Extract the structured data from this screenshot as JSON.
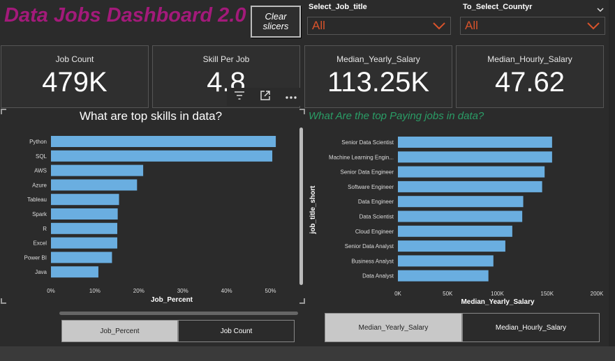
{
  "header": {
    "title": "Data Jobs Dashboard 2.0",
    "clear_button": "Clear slicers"
  },
  "slicers": [
    {
      "label": "Select_Job_title",
      "value": "All"
    },
    {
      "label": "To_Select_Countyr",
      "value": "All"
    }
  ],
  "kpis": [
    {
      "label": "Job Count",
      "value": "479K"
    },
    {
      "label": "Skill Per Job",
      "value": "4.8"
    },
    {
      "label": "Median_Yearly_Salary",
      "value": "113.25K"
    },
    {
      "label": "Median_Hourly_Salary",
      "value": "47.62"
    }
  ],
  "chart_data": [
    {
      "type": "bar",
      "orientation": "horizontal",
      "title": "What are top skills in data?",
      "xlabel": "Job_Percent",
      "ylabel": "",
      "categories": [
        "Python",
        "SQL",
        "AWS",
        "Azure",
        "Tableau",
        "Spark",
        "R",
        "Excel",
        "Power BI",
        "Java"
      ],
      "values": [
        51.2,
        50.4,
        21.0,
        19.6,
        15.5,
        15.2,
        15.1,
        15.1,
        13.9,
        10.8
      ],
      "xlim": [
        0,
        55
      ],
      "ticks": [
        "0%",
        "10%",
        "20%",
        "30%",
        "40%",
        "50%"
      ],
      "tick_values": [
        0,
        10,
        20,
        30,
        40,
        50
      ],
      "color": "#6aaee0"
    },
    {
      "type": "bar",
      "orientation": "horizontal",
      "title": "What Are the top Paying jobs in data?",
      "xlabel": "Median_Yearly_Salary",
      "ylabel": "job_title_short",
      "categories": [
        "Senior Data Scientist",
        "Machine Learning Engin...",
        "Senior Data Engineer",
        "Software Engineer",
        "Data Engineer",
        "Data Scientist",
        "Cloud Engineer",
        "Senior Data Analyst",
        "Business Analyst",
        "Data Analyst"
      ],
      "values": [
        155000,
        155000,
        147500,
        145000,
        126000,
        125000,
        115000,
        108000,
        96000,
        91000
      ],
      "xlim": [
        0,
        200000
      ],
      "ticks": [
        "0K",
        "50K",
        "100K",
        "150K",
        "200K"
      ],
      "tick_values": [
        0,
        50000,
        100000,
        150000,
        200000
      ],
      "color": "#6aaee0"
    }
  ],
  "toggles_left": [
    "Job_Percent",
    "Job Count"
  ],
  "toggles_right": [
    "Median_Yearly_Salary",
    "Median_Hourly_Salary"
  ],
  "icons": [
    "filter-icon",
    "focus-mode-icon",
    "more-options-icon",
    "chevron-down-icon"
  ]
}
